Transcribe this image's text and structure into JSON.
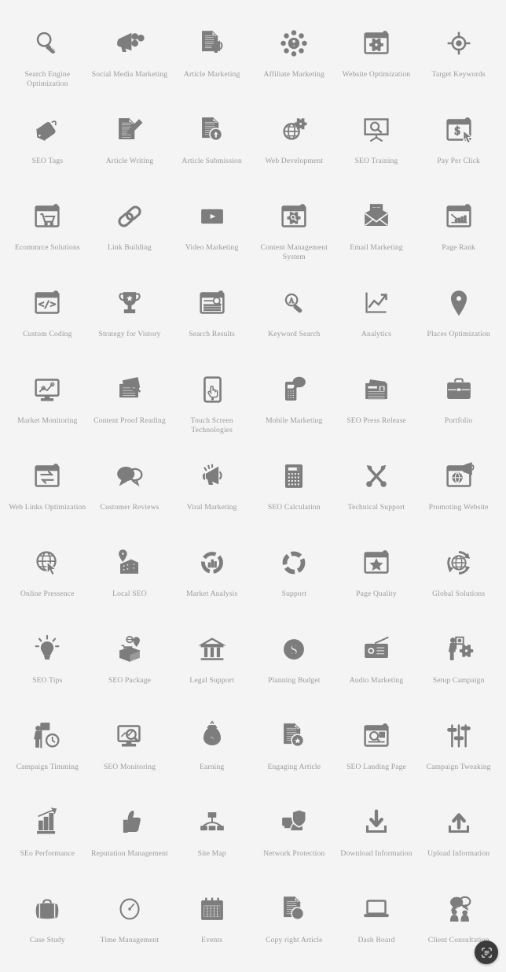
{
  "page": {
    "background_color": "#f4f4f4",
    "icon_color": "#7d7d7d",
    "label_color": "#9a9a9a",
    "columns": 6,
    "rows": 11,
    "total_icons": 66
  },
  "fab": {
    "name": "scan-lens-button",
    "icon": "scan-frame-icon",
    "background_color": "#3b3b3b",
    "icon_color": "#e8e8e8"
  },
  "icons": [
    {
      "label": "Search Engine Optimization",
      "icon": "magnifier-icon"
    },
    {
      "label": "Social Media Marketing",
      "icon": "megaphone-social-icon"
    },
    {
      "label": "Article Marketing",
      "icon": "document-megaphone-icon"
    },
    {
      "label": "Affiliate Marketing",
      "icon": "network-users-icon"
    },
    {
      "label": "Website Optimization",
      "icon": "browser-gear-icon"
    },
    {
      "label": "Target Keywords",
      "icon": "crosshair-target-icon"
    },
    {
      "label": "SEO Tags",
      "icon": "price-tag-seo-icon"
    },
    {
      "label": "Article Writing",
      "icon": "document-pencil-icon"
    },
    {
      "label": "Article Submission",
      "icon": "document-upload-icon"
    },
    {
      "label": "Web Development",
      "icon": "globe-gear-icon"
    },
    {
      "label": "SEO Training",
      "icon": "presentation-magnifier-icon"
    },
    {
      "label": "Pay Per Click",
      "icon": "browser-dollar-cursor-icon"
    },
    {
      "label": "Ecommrce Solutions",
      "icon": "browser-cart-icon"
    },
    {
      "label": "Link Building",
      "icon": "chain-link-icon"
    },
    {
      "label": "Video Marketing",
      "icon": "video-play-icon"
    },
    {
      "label": "Content Management System",
      "icon": "browser-gear-magnifier-icon"
    },
    {
      "label": "Email Marketing",
      "icon": "envelope-document-icon"
    },
    {
      "label": "Page Rank",
      "icon": "browser-declining-chart-icon"
    },
    {
      "label": "Custom Coding",
      "icon": "browser-code-icon"
    },
    {
      "label": "Strategy for Vistory",
      "icon": "trophy-star-icon"
    },
    {
      "label": "Search Results",
      "icon": "browser-search-results-icon"
    },
    {
      "label": "Keyword Search",
      "icon": "letter-a-magnifier-icon"
    },
    {
      "label": "Analytics",
      "icon": "line-chart-arrow-icon"
    },
    {
      "label": "Places Optimization",
      "icon": "map-pin-icon"
    },
    {
      "label": "Market Monitoring",
      "icon": "monitor-chart-icon"
    },
    {
      "label": "Content Proof Reading",
      "icon": "papers-magnifier-icon"
    },
    {
      "label": "Touch Screen Technologies",
      "icon": "tablet-hand-icon"
    },
    {
      "label": "Mobile Marketing",
      "icon": "phone-sms-icon"
    },
    {
      "label": "SEO Press Release",
      "icon": "newspaper-icon"
    },
    {
      "label": "Portfolio",
      "icon": "briefcase-icon"
    },
    {
      "label": "Web Links Optimization",
      "icon": "browser-exchange-arrows-icon"
    },
    {
      "label": "Customer Reviews",
      "icon": "speech-bubbles-icon"
    },
    {
      "label": "Viral Marketing",
      "icon": "megaphone-burst-icon"
    },
    {
      "label": "SEO Calculation",
      "icon": "calculator-icon"
    },
    {
      "label": "Technical Support",
      "icon": "wrench-screwdriver-icon"
    },
    {
      "label": "Promoting Website",
      "icon": "browser-globe-megaphone-icon"
    },
    {
      "label": "Online Pressence",
      "icon": "globe-cursor-icon"
    },
    {
      "label": "Local SEO",
      "icon": "pin-buildings-icon"
    },
    {
      "label": "Market Analysis",
      "icon": "donut-bars-icon"
    },
    {
      "label": "Support",
      "icon": "lifebuoy-ring-icon"
    },
    {
      "label": "Page Quality",
      "icon": "browser-star-icon"
    },
    {
      "label": "Global Solutions",
      "icon": "globe-arrows-icon"
    },
    {
      "label": "SEO Tips",
      "icon": "lightbulb-icon"
    },
    {
      "label": "SEO Package",
      "icon": "open-box-icons-icon"
    },
    {
      "label": "Legal Support",
      "icon": "bank-columns-icon"
    },
    {
      "label": "Planning Budget",
      "icon": "dollar-coin-icon"
    },
    {
      "label": "Audio Marketing",
      "icon": "radio-icon"
    },
    {
      "label": "Setup Campaign",
      "icon": "person-flag-gear-icon"
    },
    {
      "label": "Campaign Timming",
      "icon": "person-flag-clock-icon"
    },
    {
      "label": "SEO Monitoring",
      "icon": "monitor-magnifier-icon"
    },
    {
      "label": "Earning",
      "icon": "money-bag-icon"
    },
    {
      "label": "Engaging Article",
      "icon": "document-star-icon"
    },
    {
      "label": "SEO Landing Page",
      "icon": "browser-magnifier-page-icon"
    },
    {
      "label": "Campaign Tweaking",
      "icon": "sliders-icon"
    },
    {
      "label": "SEo Performance",
      "icon": "bar-chart-arrow-icon"
    },
    {
      "label": "Reputation Management",
      "icon": "thumbs-up-icon"
    },
    {
      "label": "Site Map",
      "icon": "sitemap-hierarchy-icon"
    },
    {
      "label": "Network Protection",
      "icon": "computers-shield-icon"
    },
    {
      "label": "Download Information",
      "icon": "download-arrow-icon"
    },
    {
      "label": "Upload Information",
      "icon": "upload-arrow-icon"
    },
    {
      "label": "Case Study",
      "icon": "suitcase-icon"
    },
    {
      "label": "Time Management",
      "icon": "clock-icon"
    },
    {
      "label": "Events",
      "icon": "calendar-icon"
    },
    {
      "label": "Copy right Article",
      "icon": "document-copyright-icon"
    },
    {
      "label": "Dash Board",
      "icon": "laptop-icon"
    },
    {
      "label": "Client Consultation",
      "icon": "two-people-chat-icon"
    }
  ]
}
